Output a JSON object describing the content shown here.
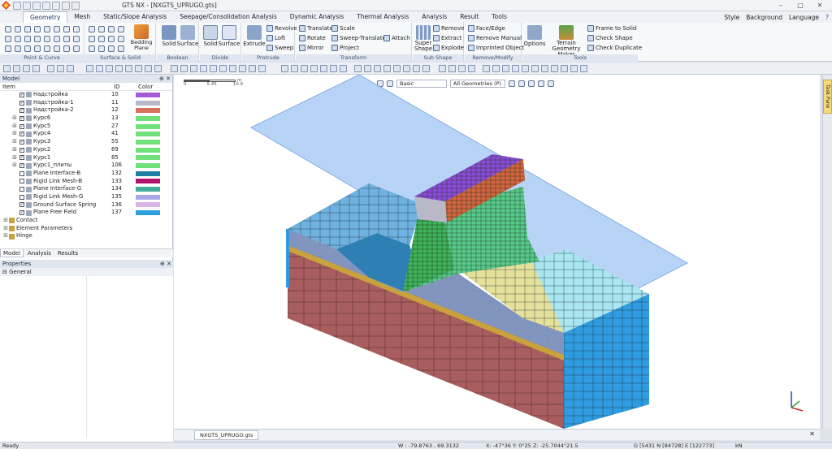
{
  "window": {
    "title": "GTS NX - [NXGTS_UPRUGO.gts]"
  },
  "menu": {
    "tabs": [
      "Geometry",
      "Mesh",
      "Static/Slope Analysis",
      "Seepage/Consolidation Analysis",
      "Dynamic Analysis",
      "Thermal Analysis",
      "Analysis",
      "Result",
      "Tools"
    ],
    "right": [
      "Style",
      "Background",
      "Language"
    ]
  },
  "ribbon": {
    "groups": [
      "Point & Curve",
      "Surface & Solid",
      "Boolean",
      "Divide",
      "Protrude",
      "Transform",
      "Sub Shape",
      "Remove/Modify",
      "Tools"
    ],
    "bedding": "Bedding Plane",
    "boolean": [
      "Solid",
      "Surface"
    ],
    "divide": [
      "Solid",
      "Surface"
    ],
    "protrude": {
      "big": "Extrude",
      "items": [
        "Revolve",
        "Loft",
        "Sweep"
      ]
    },
    "transform": [
      "Translate",
      "Rotate",
      "Mirror",
      "Scale",
      "Sweep-Translate",
      "Project",
      "Attach"
    ],
    "subshape": {
      "big": "Super Shape",
      "items": [
        "Remove",
        "Extract",
        "Explode"
      ]
    },
    "remove": [
      "Face/Edge",
      "Remove Manual",
      "Imprinted Object"
    ],
    "tools": {
      "options": "Options",
      "terrain": "Terrain Geometry Maker",
      "items": [
        "Frame to Solid",
        "Check Shape",
        "Check Duplicate"
      ]
    }
  },
  "model": {
    "title": "Model",
    "cols": [
      "Item",
      "ID",
      "Color"
    ],
    "rows": [
      {
        "name": "Надстройка",
        "id": "10",
        "color": "#a35bd6",
        "checked": true,
        "exp": false
      },
      {
        "name": "Надстройка-1",
        "id": "11",
        "color": "#b8b8c8",
        "checked": true,
        "exp": false
      },
      {
        "name": "Надстройка-2",
        "id": "12",
        "color": "#d8705a",
        "checked": true,
        "exp": false
      },
      {
        "name": "Курс6",
        "id": "13",
        "color": "#6fe07a",
        "checked": true,
        "exp": true
      },
      {
        "name": "Курс5",
        "id": "27",
        "color": "#6fe07a",
        "checked": true,
        "exp": true
      },
      {
        "name": "Курс4",
        "id": "41",
        "color": "#6fe07a",
        "checked": true,
        "exp": true
      },
      {
        "name": "Курс3",
        "id": "55",
        "color": "#6fe07a",
        "checked": true,
        "exp": true
      },
      {
        "name": "Курс2",
        "id": "69",
        "color": "#6fe07a",
        "checked": true,
        "exp": true
      },
      {
        "name": "Курс1",
        "id": "85",
        "color": "#6fe07a",
        "checked": true,
        "exp": true
      },
      {
        "name": "Курс1_плиты",
        "id": "106",
        "color": "#6fe07a",
        "checked": true,
        "exp": true
      },
      {
        "name": "Plane Interface-B",
        "id": "132",
        "color": "#1c7fa3",
        "checked": false,
        "exp": false
      },
      {
        "name": "Rigid Link Mesh-B",
        "id": "133",
        "color": "#b0156e",
        "checked": false,
        "exp": false
      },
      {
        "name": "Plane Interface-G",
        "id": "134",
        "color": "#3fae9a",
        "checked": false,
        "exp": false
      },
      {
        "name": "Rigid Link Mesh-G",
        "id": "135",
        "color": "#a9a9e8",
        "checked": false,
        "exp": false
      },
      {
        "name": "Ground Surface Spring",
        "id": "136",
        "color": "#d7b4e4",
        "checked": true,
        "exp": false
      },
      {
        "name": "Plane Free Field",
        "id": "137",
        "color": "#2e9fe0",
        "checked": true,
        "exp": false
      }
    ],
    "groups": [
      "Contact",
      "Element Parameters",
      "Hinge"
    ]
  },
  "pane_tabs": [
    "Model",
    "Analysis",
    "Results"
  ],
  "properties": {
    "title": "Properties",
    "section": "General"
  },
  "viewport": {
    "scale": [
      "0",
      "5.45",
      "10.9"
    ],
    "scale_unit": "m",
    "mode": "Basic",
    "filter": "All Geometries (P)"
  },
  "taskpane": "Task Pane",
  "doc_tab": "NXGTS_UPRUGO.gts",
  "status": {
    "ready": "Ready",
    "w": "W : -79.8763 , 69.3132",
    "coords": "X: -47°36  Y: 0°25  Z: -25.7044°21.5",
    "g": "G [5431 N [84728] E [122773]",
    "unit": "kN"
  }
}
